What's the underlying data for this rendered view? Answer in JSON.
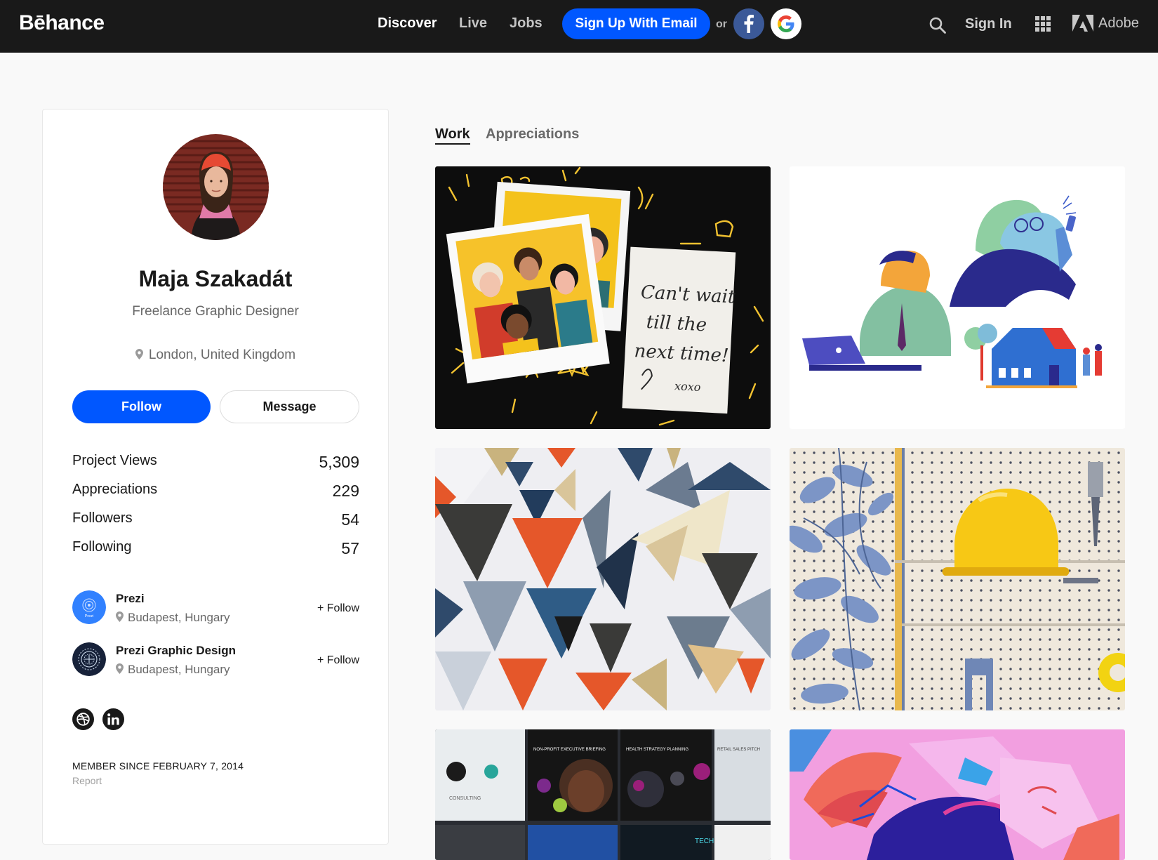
{
  "nav": {
    "logo": "Bēhance",
    "discover": "Discover",
    "live": "Live",
    "jobs": "Jobs",
    "signup": "Sign Up With Email",
    "or": "or",
    "signin": "Sign In",
    "adobe": "Adobe",
    "icons": [
      "facebook-icon",
      "google-icon",
      "search-icon",
      "apps-grid-icon",
      "adobe-logo"
    ]
  },
  "profile": {
    "name": "Maja Szakadát",
    "title": "Freelance Graphic Designer",
    "location": "London, United Kingdom",
    "follow_label": "Follow",
    "message_label": "Message",
    "stats": [
      {
        "label": "Project Views",
        "value": "5,309"
      },
      {
        "label": "Appreciations",
        "value": "229"
      },
      {
        "label": "Followers",
        "value": "54"
      },
      {
        "label": "Following",
        "value": "57"
      }
    ],
    "teams": [
      {
        "name": "Prezi",
        "location": "Budapest, Hungary",
        "follow": "+ Follow",
        "logo_text": "Prezi"
      },
      {
        "name": "Prezi Graphic Design",
        "location": "Budapest, Hungary",
        "follow": "+ Follow"
      }
    ],
    "social": [
      "dribbble-icon",
      "linkedin-icon"
    ],
    "member_since": "MEMBER SINCE FEBRUARY 7, 2014",
    "report": "Report"
  },
  "tabs": {
    "work": "Work",
    "appreciations": "Appreciations"
  },
  "projects": {
    "note_lines": [
      "Can't wait",
      "till the",
      "next time!",
      "xoxo"
    ],
    "slide_texts": [
      "NON-PROFIT EXECUTIVE BRIEFING",
      "HEALTH STRATEGY PLANNING",
      "RETAIL SALES PITCH",
      "CONSULTING",
      "TECH"
    ]
  },
  "colors": {
    "accent": "#0057ff",
    "topbar": "#191919",
    "page_bg": "#f9f9f9"
  }
}
